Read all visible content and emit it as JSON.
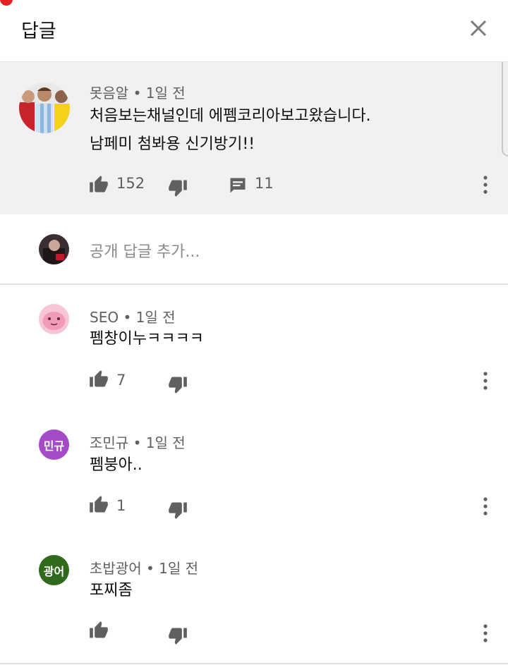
{
  "header": {
    "title": "답글"
  },
  "parent_comment": {
    "author": "못음알",
    "time": "1일 전",
    "text_lines": [
      "처음보는채널인데 에펨코리아보고왔습니다.",
      "남페미 첨봐용 신기방기!!"
    ],
    "likes": "152",
    "replies": "11"
  },
  "add_reply": {
    "placeholder": "공개 답글 추가..."
  },
  "replies": [
    {
      "author": "SEO",
      "time": "1일 전",
      "text": "펨창이누ㅋㅋㅋㅋ",
      "likes": "7"
    },
    {
      "author": "조민규",
      "time": "1일 전",
      "text": "펨붕아..",
      "likes": "1",
      "avatar_text": "민규",
      "avatar_color": "#a64bc8"
    },
    {
      "author": "초밥광어",
      "time": "1일 전",
      "text": "포찌좀",
      "likes": "",
      "avatar_text": "광어",
      "avatar_color": "#2f6a1d"
    }
  ],
  "colors": {
    "parent_bg": "#f1f1f1",
    "meta_text": "#606060",
    "icon": "#606060"
  },
  "icons": [
    "close-icon",
    "thumb-up-icon",
    "thumb-down-icon",
    "comment-icon",
    "more-vert-icon"
  ]
}
